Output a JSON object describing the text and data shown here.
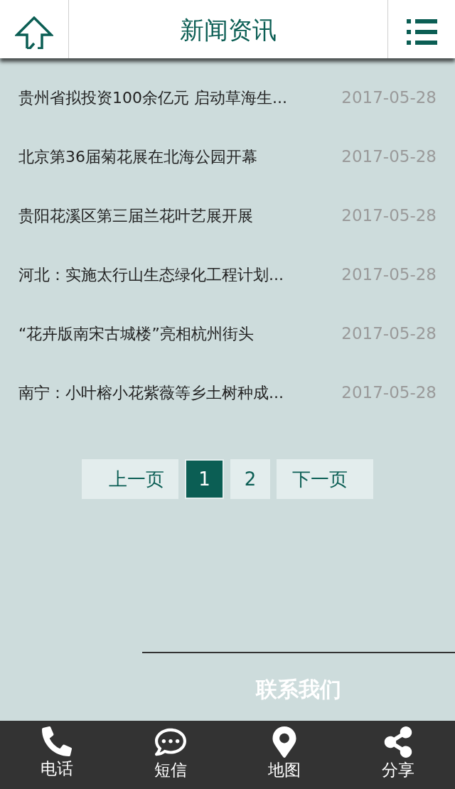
{
  "header": {
    "title": "新闻资讯"
  },
  "news": [
    {
      "title": "贵州省拟投资100余亿元 启动草海生...",
      "date": "2017-05-28"
    },
    {
      "title": "北京第36届菊花展在北海公园开幕",
      "date": "2017-05-28"
    },
    {
      "title": "贵阳花溪区第三届兰花叶艺展开展",
      "date": "2017-05-28"
    },
    {
      "title": "河北：实施太行山生态绿化工程计划...",
      "date": "2017-05-28"
    },
    {
      "title": "“花卉版南宋古城楼”亮相杭州街头",
      "date": "2017-05-28"
    },
    {
      "title": "南宁：小叶榕小花紫薇等乡土树种成...",
      "date": "2017-05-28"
    }
  ],
  "pagination": {
    "prev": "上一页",
    "pages": [
      {
        "label": "1",
        "selected": true
      },
      {
        "label": "2",
        "selected": false
      }
    ],
    "next": "下一页"
  },
  "contact": {
    "heading": "联系我们"
  },
  "bottom_nav": [
    {
      "kind": "phone",
      "label": "电话"
    },
    {
      "kind": "message",
      "label": "短信"
    },
    {
      "kind": "map",
      "label": "地图"
    },
    {
      "kind": "share",
      "label": "分享"
    }
  ]
}
